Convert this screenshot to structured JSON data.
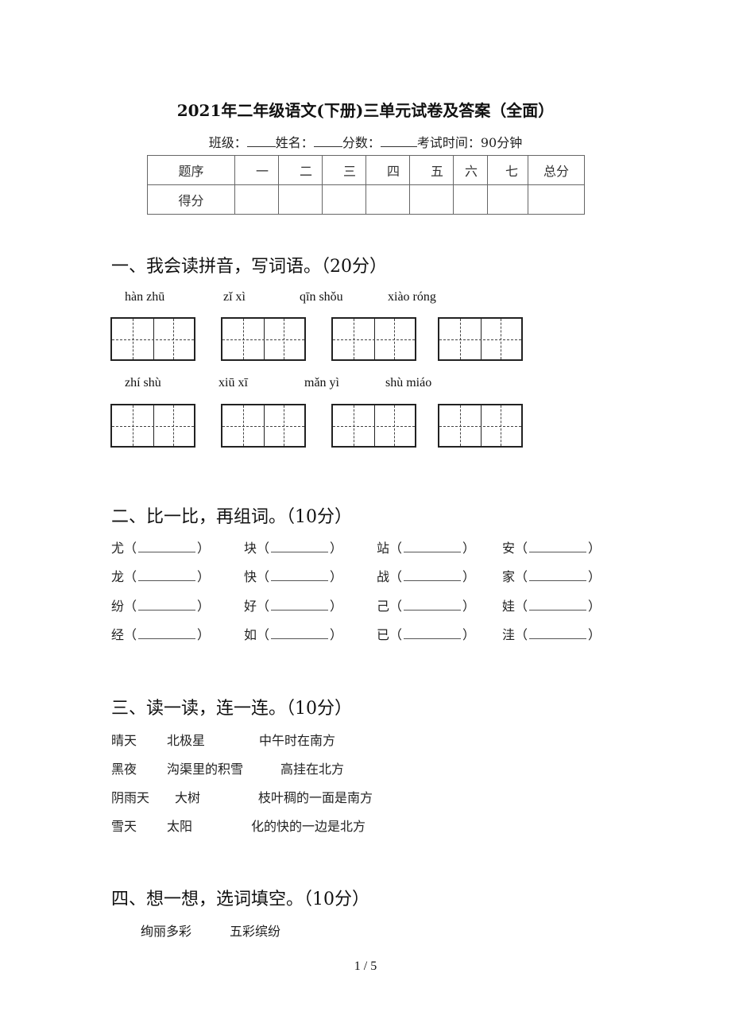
{
  "title": "2021年二年级语文(下册)三单元试卷及答案（全面）",
  "info": {
    "class_label": "班级：",
    "name_label": "姓名：",
    "score_label": "分数：",
    "time_label": "考试时间：90分钟"
  },
  "score_table": {
    "header_label": "题序",
    "columns": [
      "一",
      "二",
      "三",
      "四",
      "五",
      "六",
      "七"
    ],
    "total_label": "总分",
    "row_label": "得分"
  },
  "section1": {
    "heading": "一、我会读拼音，写词语。（20分）",
    "row1": [
      "hàn zhū",
      "zǐ xì",
      "qīn shǒu",
      "xiào róng"
    ],
    "row2": [
      "zhí shù",
      "xiū xī",
      "mǎn yì",
      "shù miáo"
    ]
  },
  "section2": {
    "heading": "二、比一比，再组词。（10分）",
    "rows": [
      [
        "尤",
        "块",
        "站",
        "安"
      ],
      [
        "龙",
        "快",
        "战",
        "家"
      ],
      [
        "纷",
        "好",
        "己",
        "娃"
      ],
      [
        "经",
        "如",
        "已",
        "洼"
      ]
    ],
    "open_paren": "（",
    "close_paren": "）"
  },
  "section3": {
    "heading": "三、读一读，连一连。（10分）",
    "col1": [
      "晴天",
      "黑夜",
      "阴雨天",
      "雪天"
    ],
    "col2": [
      "北极星",
      "沟渠里的积雪",
      "大树",
      "太阳"
    ],
    "col3": [
      "中午时在南方",
      "高挂在北方",
      "枝叶稠的一面是南方",
      "化的快的一边是北方"
    ]
  },
  "section4": {
    "heading": "四、想一想，选词填空。（10分）",
    "options": [
      "绚丽多彩",
      "五彩缤纷"
    ]
  },
  "page_number": "1 / 5"
}
